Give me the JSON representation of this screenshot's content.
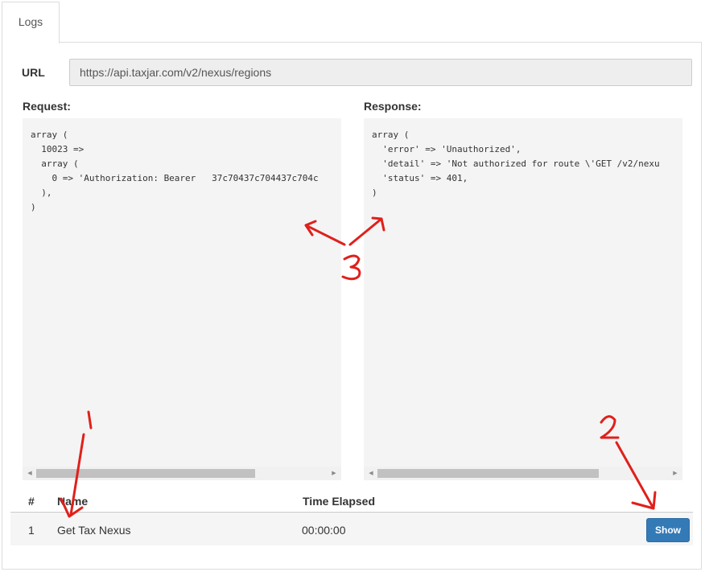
{
  "tabs": [
    {
      "label": "Logs"
    }
  ],
  "url": {
    "label": "URL",
    "value": "https://api.taxjar.com/v2/nexus/regions"
  },
  "request": {
    "label": "Request:",
    "code": "array (\n  10023 =>\n  array (\n    0 => 'Authorization: Bearer   37c70437c704437c704c\n  ),\n)"
  },
  "response": {
    "label": "Response:",
    "code": "array (\n  'error' => 'Unauthorized',\n  'detail' => 'Not authorized for route \\'GET /v2/nexu\n  'status' => 401,\n)"
  },
  "table": {
    "headers": [
      "#",
      "Name",
      "Time Elapsed"
    ],
    "rows": [
      {
        "num": "1",
        "name": "Get Tax Nexus",
        "time": "00:00:00",
        "action": "Show"
      }
    ]
  },
  "annotations": [
    "1",
    "2",
    "3"
  ],
  "colors": {
    "annotation": "#e0201b",
    "button": "#337ab7",
    "code_bg": "#f4f4f4"
  },
  "scrollbars": {
    "request_thumb_fraction": 0.75,
    "response_thumb_fraction": 0.76
  }
}
